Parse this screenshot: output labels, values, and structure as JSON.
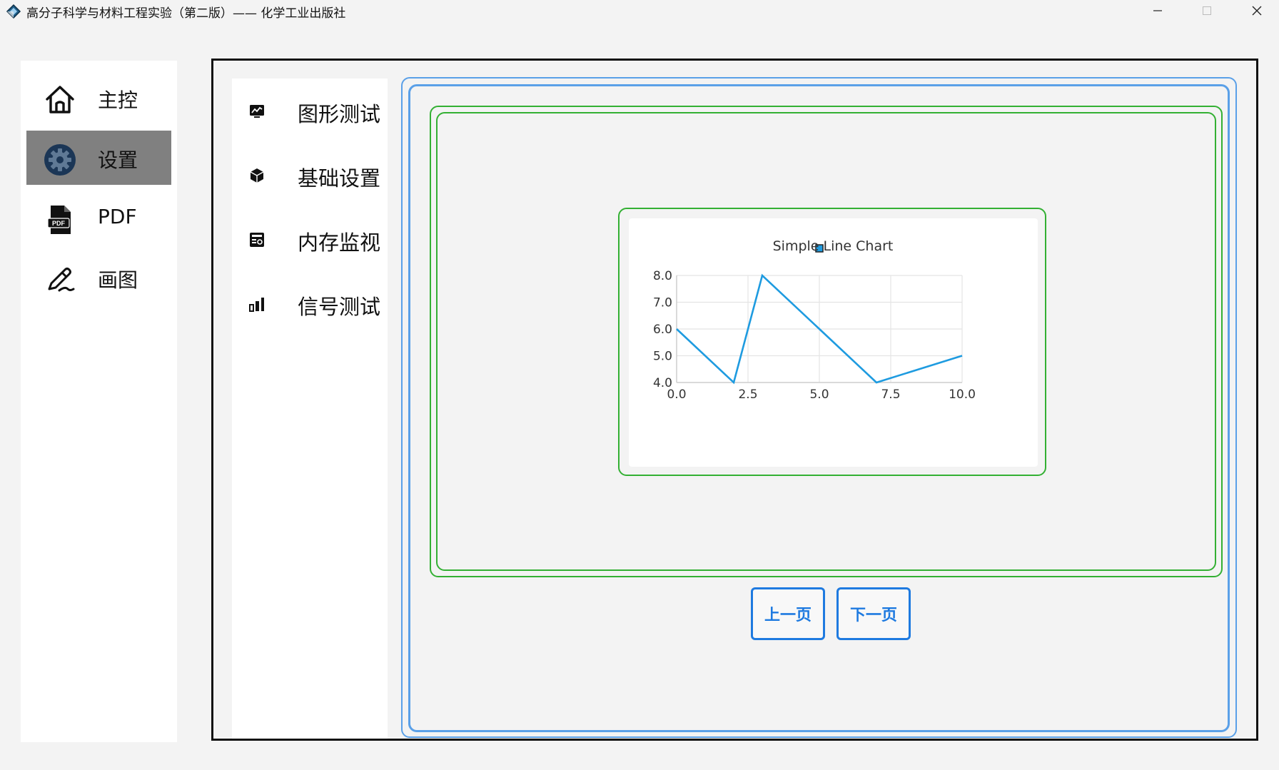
{
  "window": {
    "title": "高分子科学与材料工程实验（第二版）—— 化学工业出版社"
  },
  "nav": {
    "items": [
      {
        "label": "主控",
        "icon": "home-icon"
      },
      {
        "label": "设置",
        "icon": "gear-icon",
        "active": true
      },
      {
        "label": "PDF",
        "icon": "pdf-file-icon"
      },
      {
        "label": "画图",
        "icon": "pen-icon"
      }
    ]
  },
  "subnav": {
    "items": [
      {
        "label": "图形测试",
        "icon": "chart-monitor-icon"
      },
      {
        "label": "基础设置",
        "icon": "cube-icon"
      },
      {
        "label": "内存监视",
        "icon": "memory-icon"
      },
      {
        "label": "信号测试",
        "icon": "signal-bars-icon"
      }
    ]
  },
  "pager": {
    "prev_label": "上一页",
    "next_label": "下一页"
  },
  "colors": {
    "accent": "#1e7ae0",
    "frame_blue": "#5aa0e8",
    "frame_green": "#33b033",
    "series": "#1e9be0",
    "nav_active": "#808080"
  },
  "chart_data": {
    "type": "line",
    "title": "Simple Line Chart",
    "xlabel": "",
    "ylabel": "",
    "x": [
      0,
      2,
      3,
      5,
      7,
      10
    ],
    "series": [
      {
        "values": [
          6,
          4,
          8,
          6,
          4,
          5
        ]
      }
    ],
    "xlim": [
      0,
      10
    ],
    "ylim": [
      4,
      8
    ],
    "xticks": [
      "0.0",
      "2.5",
      "5.0",
      "7.5",
      "10.0"
    ],
    "yticks": [
      "4.0",
      "5.0",
      "6.0",
      "7.0",
      "8.0"
    ],
    "grid": true,
    "legend": "top-center"
  }
}
